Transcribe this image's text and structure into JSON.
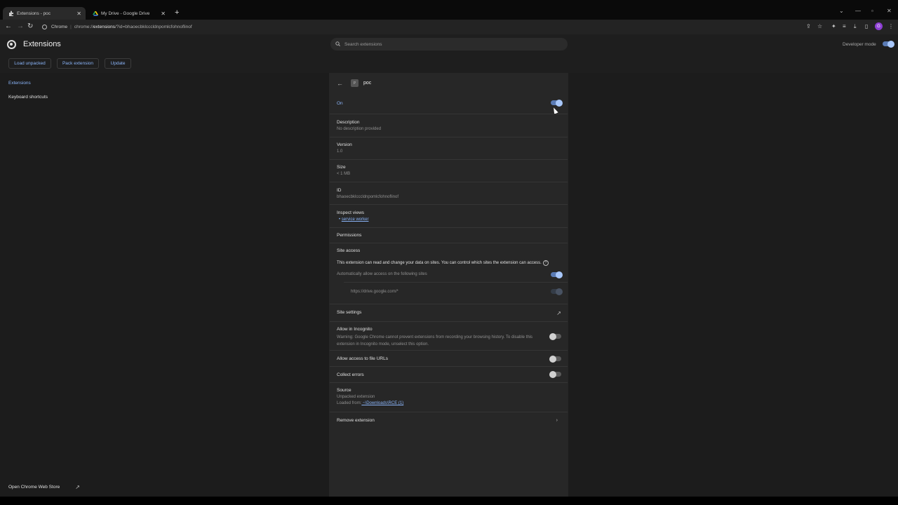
{
  "tabs": [
    {
      "title": "Extensions - poc",
      "icon": "puzzle-icon"
    },
    {
      "title": "My Drive - Google Drive",
      "icon": "drive-icon"
    }
  ],
  "address_bar": {
    "site": "Chrome",
    "url_host": "chrome://",
    "url_bold": "extensions",
    "url_rest": "/?id=bhaoecbklcccldnpomlcfohnoflinof"
  },
  "header": {
    "title": "Extensions",
    "search_placeholder": "Search extensions",
    "developer_mode_label": "Developer mode"
  },
  "toolbar": {
    "load_unpacked": "Load unpacked",
    "pack_extension": "Pack extension",
    "update": "Update"
  },
  "sidebar": {
    "items": [
      {
        "label": "Extensions"
      },
      {
        "label": "Keyboard shortcuts"
      }
    ],
    "web_store": "Open Chrome Web Store"
  },
  "detail": {
    "name": "poc",
    "icon_letter": "P",
    "on_label": "On",
    "description_label": "Description",
    "description_value": "No description provided",
    "version_label": "Version",
    "version_value": "1.0",
    "size_label": "Size",
    "size_value": "< 1 MB",
    "id_label": "ID",
    "id_value": "bhaoecbklcccldnpomlcfohnoflinof",
    "inspect_label": "Inspect views",
    "inspect_link": "service worker",
    "permissions_label": "Permissions",
    "site_access_label": "Site access",
    "site_access_text": "This extension can read and change your data on sites. You can control which sites the extension can access.",
    "auto_allow_label": "Automatically allow access on the following sites",
    "site_pattern": "https://drive.google.com/*",
    "site_settings_label": "Site settings",
    "incognito_label": "Allow in Incognito",
    "incognito_warning": "Warning: Google Chrome cannot prevent extensions from recording your browsing history. To disable this extension in Incognito mode, unselect this option.",
    "file_urls_label": "Allow access to file URLs",
    "collect_errors_label": "Collect errors",
    "source_label": "Source",
    "source_value": "Unpacked extension",
    "loaded_from_label": "Loaded from:",
    "loaded_from_path": " ~\\Downloads\\RCE (1)",
    "remove_label": "Remove extension"
  },
  "colors": {
    "accent": "#8ab4f8",
    "panel": "#272727",
    "background": "#1c1c1c"
  }
}
